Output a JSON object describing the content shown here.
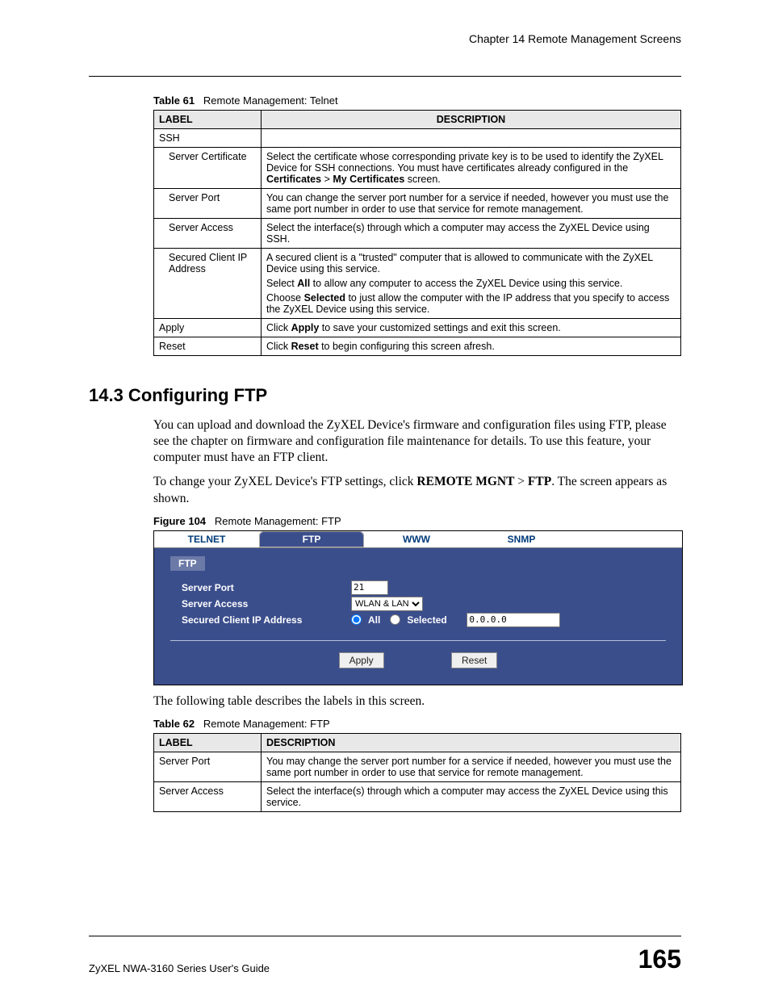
{
  "chapter_header": "Chapter 14 Remote Management Screens",
  "table61": {
    "caption_bold": "Table 61",
    "caption_rest": "Remote Management: Telnet",
    "headers": {
      "label": "LABEL",
      "description": "DESCRIPTION"
    },
    "rows": {
      "ssh": {
        "label": "SSH",
        "desc": ""
      },
      "server_cert": {
        "label": "Server Certificate",
        "desc_1": "Select the certificate whose corresponding private key is to be used to identify the ZyXEL Device for SSH connections. You must have certificates already configured in the ",
        "desc_bold1": "Certificates",
        "desc_sep": " > ",
        "desc_bold2": "My Certificates",
        "desc_2": " screen."
      },
      "server_port": {
        "label": "Server Port",
        "desc": "You can change the server port number for a service if needed, however you must use the same port number in order to use that service for remote management."
      },
      "server_access": {
        "label": "Server Access",
        "desc": "Select the interface(s) through which a computer may access the ZyXEL Device using SSH."
      },
      "secured_client": {
        "label": "Secured Client IP Address",
        "p1": "A secured client is a \"trusted\" computer that is allowed to communicate with the ZyXEL Device using this service.",
        "p2a": "Select ",
        "p2b": "All",
        "p2c": " to allow any computer to access the ZyXEL Device using this service.",
        "p3a": "Choose ",
        "p3b": "Selected",
        "p3c": " to just allow the computer with the IP address that you specify to access the ZyXEL Device using this service."
      },
      "apply": {
        "label": "Apply",
        "a": "Click ",
        "b": "Apply",
        "c": " to save your customized settings and exit this screen."
      },
      "reset": {
        "label": "Reset",
        "a": "Click ",
        "b": "Reset",
        "c": " to begin configuring this screen afresh."
      }
    }
  },
  "section": {
    "heading": "14.3  Configuring FTP",
    "para1": "You can upload and download the ZyXEL Device's firmware and configuration files using FTP, please see the chapter on firmware and configuration file maintenance for details. To use this feature, your computer must have an FTP client.",
    "para2a": "To change your ZyXEL Device's FTP settings, click ",
    "para2b": "REMOTE MGNT",
    "para2sep": " > ",
    "para2c": "FTP",
    "para2d": ". The screen appears as shown."
  },
  "figure104": {
    "caption_bold": "Figure 104",
    "caption_rest": "Remote Management: FTP",
    "tabs": {
      "telnet": "TELNET",
      "ftp": "FTP",
      "www": "WWW",
      "snmp": "SNMP"
    },
    "panel_label": "FTP",
    "labels": {
      "server_port": "Server Port",
      "server_access": "Server Access",
      "secured_client": "Secured Client IP Address"
    },
    "values": {
      "server_port": "21",
      "server_access": "WLAN & LAN",
      "ip": "0.0.0.0"
    },
    "radios": {
      "all": "All",
      "selected": "Selected"
    },
    "buttons": {
      "apply": "Apply",
      "reset": "Reset"
    }
  },
  "after_figure": "The following table describes the labels in this screen.",
  "table62": {
    "caption_bold": "Table 62",
    "caption_rest": "Remote Management: FTP",
    "headers": {
      "label": "LABEL",
      "description": "DESCRIPTION"
    },
    "rows": {
      "server_port": {
        "label": "Server Port",
        "desc": "You may change the server port number for a service if needed, however you must use the same port number in order to use that service for remote management."
      },
      "server_access": {
        "label": "Server Access",
        "desc": "Select the interface(s) through which a computer may access the ZyXEL Device using this service."
      }
    }
  },
  "footer": {
    "left": "ZyXEL NWA-3160 Series User's Guide",
    "right": "165"
  }
}
